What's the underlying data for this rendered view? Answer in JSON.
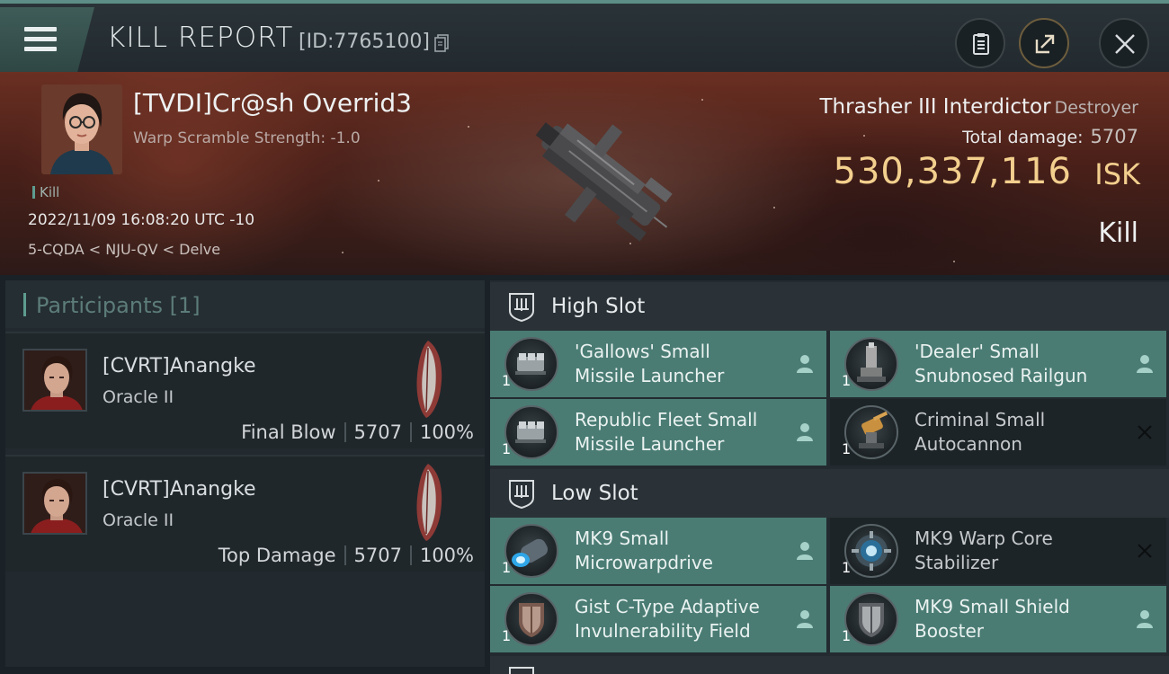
{
  "header": {
    "title": "KILL REPORT",
    "report_id": "[ID:7765100]"
  },
  "victim": {
    "name": "[TVDI]Cr@sh Overrid3",
    "subtitle": "Warp Scramble Strength: -1.0",
    "tag": "Kill",
    "datetime": "2022/11/09 16:08:20 UTC -10",
    "location": "5-CQDA < NJU-QV < Delve",
    "ship": "Thrasher III Interdictor",
    "ship_class": "Destroyer",
    "total_damage_label": "Total damage:",
    "total_damage": "5707",
    "isk_value": "530,337,116",
    "isk_unit": "ISK",
    "result": "Kill"
  },
  "participants": {
    "label": "Participants",
    "count": "[1]",
    "items": [
      {
        "name": "[CVRT]Anangke",
        "ship": "Oracle II",
        "role": "Final Blow",
        "damage": "5707",
        "percent": "100%"
      },
      {
        "name": "[CVRT]Anangke",
        "ship": "Oracle II",
        "role": "Top Damage",
        "damage": "5707",
        "percent": "100%"
      }
    ]
  },
  "fitting": {
    "high_slot": {
      "title": "High Slot",
      "modules": [
        {
          "line1": "'Gallows' Small",
          "line2": "Missile Launcher",
          "qty": "1",
          "status": "fitted",
          "icon": "missile-launcher-icon"
        },
        {
          "line1": "'Dealer' Small",
          "line2": "Snubnosed Railgun",
          "qty": "1",
          "status": "fitted",
          "icon": "railgun-icon"
        },
        {
          "line1": "Republic Fleet Small",
          "line2": "Missile Launcher",
          "qty": "1",
          "status": "fitted",
          "icon": "missile-launcher-icon"
        },
        {
          "line1": "Criminal Small",
          "line2": "Autocannon",
          "qty": "1",
          "status": "destroyed",
          "icon": "autocannon-icon"
        }
      ]
    },
    "low_slot": {
      "title": "Low Slot",
      "modules": [
        {
          "line1": "MK9 Small",
          "line2": "Microwarpdrive",
          "qty": "1",
          "status": "fitted",
          "icon": "microwarpdrive-icon"
        },
        {
          "line1": "MK9 Warp Core",
          "line2": "Stabilizer",
          "qty": "1",
          "status": "destroyed",
          "icon": "warp-core-stabilizer-icon"
        },
        {
          "line1": "Gist C-Type Adaptive",
          "line2": "Invulnerability Field",
          "qty": "1",
          "status": "fitted",
          "icon": "shield-icon"
        },
        {
          "line1": "MK9 Small Shield",
          "line2": "Booster",
          "qty": "1",
          "status": "fitted",
          "icon": "shield-booster-icon"
        }
      ]
    }
  },
  "colors": {
    "accent": "#5e9c90",
    "fitted_bg": "#4a7c74",
    "isk": "#f3cf8e"
  }
}
